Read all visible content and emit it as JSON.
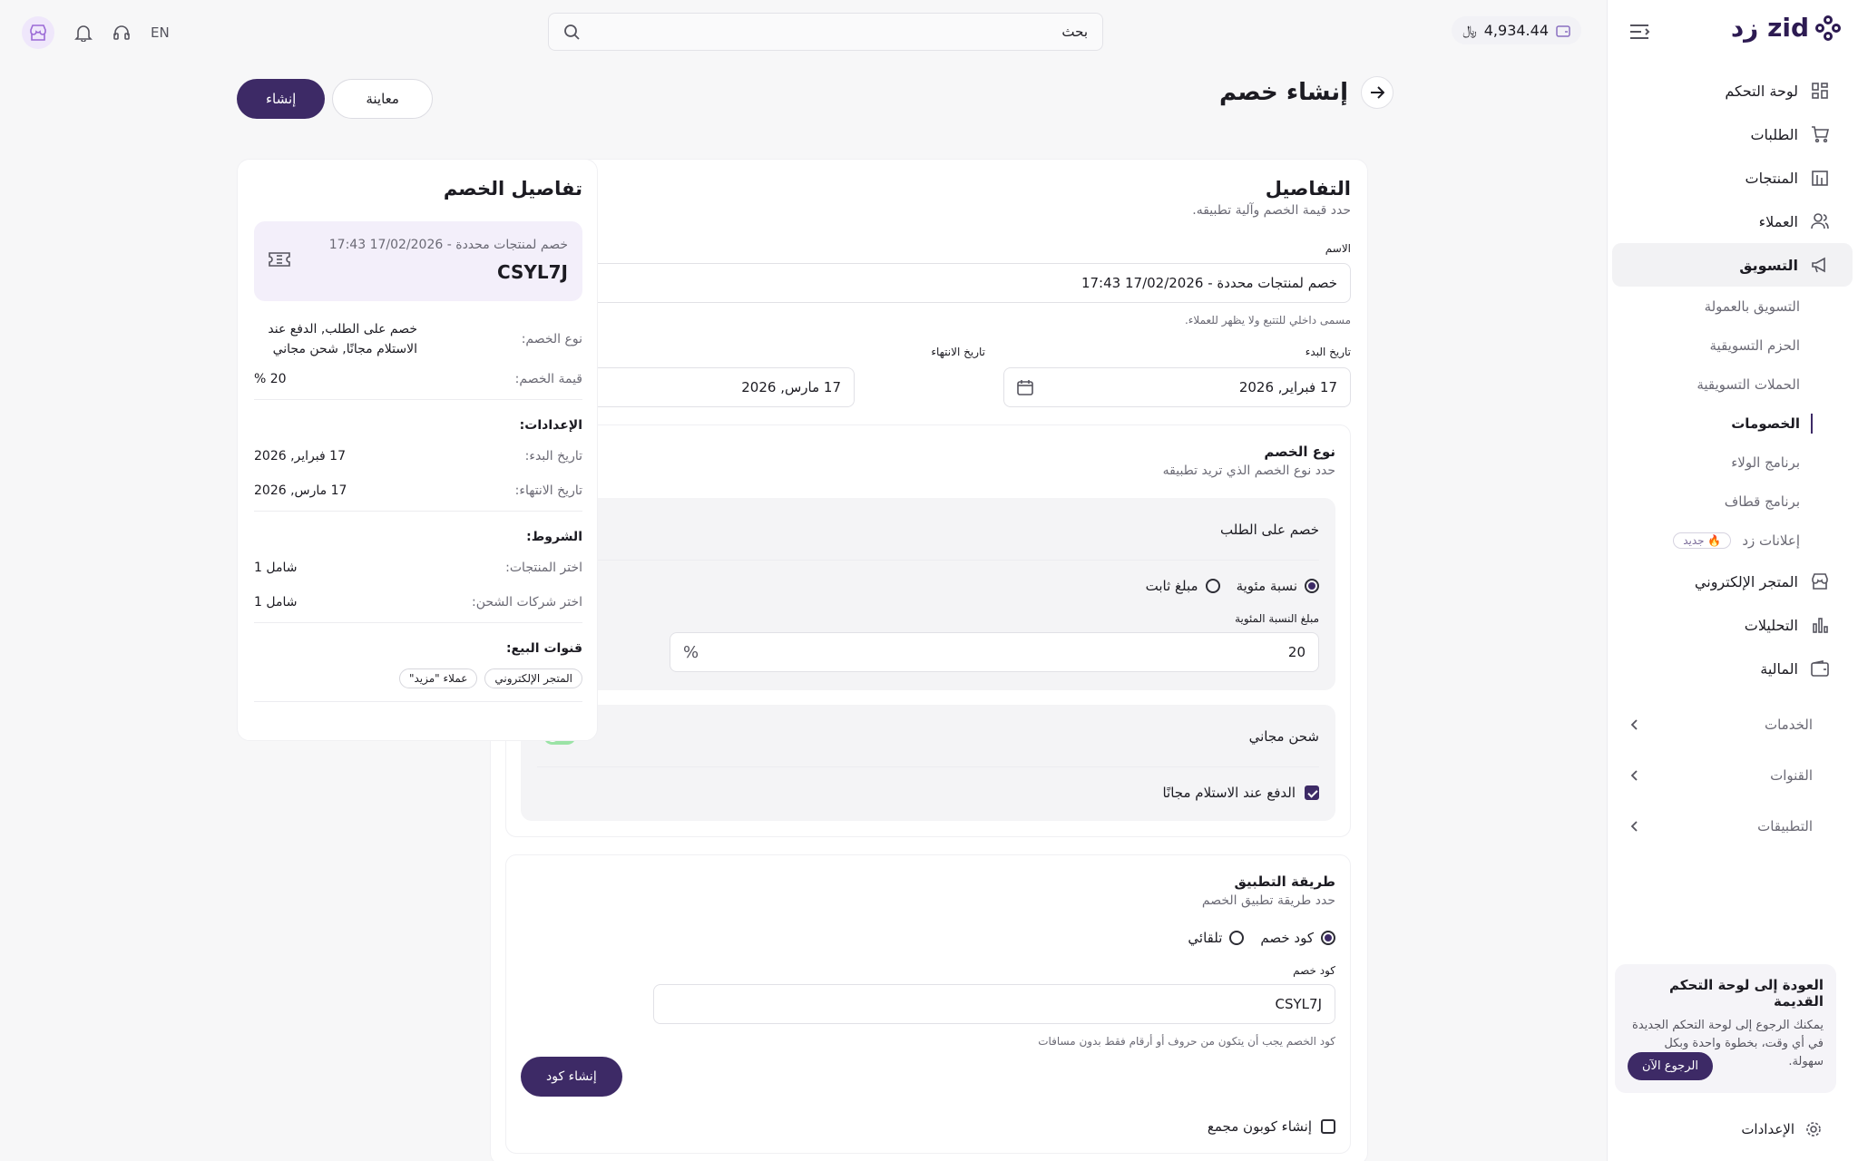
{
  "sidebar": {
    "logo_text": "zid زد",
    "items": [
      {
        "label": "لوحة التحكم",
        "icon": "grid-icon"
      },
      {
        "label": "الطلبات",
        "icon": "cart-icon"
      },
      {
        "label": "المنتجات",
        "icon": "building-icon"
      },
      {
        "label": "العملاء",
        "icon": "users-icon"
      },
      {
        "label": "التسويق",
        "icon": "megaphone-icon"
      }
    ],
    "sub_items": [
      {
        "label": "التسويق بالعمولة"
      },
      {
        "label": "الحزم التسويقية"
      },
      {
        "label": "الحملات التسويقية"
      },
      {
        "label": "الخصومات"
      },
      {
        "label": "برنامج الولاء"
      },
      {
        "label": "برنامج قطاف"
      },
      {
        "label": "إعلانات زد",
        "badge": "🔥 جديد"
      }
    ],
    "items2": [
      {
        "label": "المتجر الإلكتروني",
        "icon": "store-icon"
      },
      {
        "label": "التحليلات",
        "icon": "chart-icon"
      },
      {
        "label": "المالية",
        "icon": "wallet-icon"
      }
    ],
    "groups": [
      {
        "label": "الخدمات"
      },
      {
        "label": "القنوات"
      },
      {
        "label": "التطبيقات"
      }
    ],
    "promo": {
      "title": "العودة إلى لوحة التحكم القديمة",
      "text": "يمكنك الرجوع إلى لوحة التحكم الجديدة في أي وقت، بخطوة واحدة وبكل سهولة.",
      "button": "الرجوع الآن"
    },
    "settings": "الإعدادات"
  },
  "topbar": {
    "balance": "4,934.44",
    "search_placeholder": "بحث",
    "lang": "EN"
  },
  "header": {
    "title": "إنشاء خصم",
    "create_button": "إنشاء",
    "preview_button": "معاينة"
  },
  "details": {
    "title": "التفاصيل",
    "subtitle": "حدد قيمة الخصم وآلية تطبيقه.",
    "name_label": "الاسم",
    "name_value": "خصم لمنتجات محددة - 17/02/2026 17:43",
    "name_hint": "مسمى داخلي للتتبع ولا يظهر للعملاء.",
    "start_label": "تاريخ البدء",
    "start_value": "17 فبراير, 2026",
    "end_label": "تاريخ الانتهاء",
    "end_value": "17 مارس, 2026",
    "type_title": "نوع الخصم",
    "type_subtitle": "حدد نوع الخصم الذي تريد تطبيقه",
    "order_discount_label": "خصم على الطلب",
    "percent_label": "نسبة مئوية",
    "fixed_label": "مبلغ ثابت",
    "percent_amount_label": "مبلغ النسبة المئوية",
    "percent_amount_value": "20",
    "percent_sign": "%",
    "free_shipping_label": "شحن مجاني",
    "cod_free_label": "الدفع عند الاستلام مجانًا",
    "method_title": "طريقة التطبيق",
    "method_subtitle": "حدد طريقة تطبيق الخصم",
    "code_option": "كود خصم",
    "auto_option": "تلقائي",
    "code_label": "كود خصم",
    "code_value": "CSYL7J",
    "code_hint": "كود الخصم يجب أن يتكون من حروف أو أرقام فقط بدون مسافات",
    "generate_button": "إنشاء كود",
    "bulk_label": "إنشاء كوبون مجمع"
  },
  "summary": {
    "title": "تفاصيل الخصم",
    "box_name": "خصم لمنتجات محددة - 17/02/2026 17:43",
    "box_code": "CSYL7J",
    "type_label": "نوع الخصم:",
    "type_value": "خصم على الطلب, الدفع عند الاستلام مجانًا, شحن مجاني",
    "value_label": "قيمة الخصم:",
    "value_value": "20 %",
    "settings_title": "الإعدادات:",
    "start_label": "تاريخ البدء:",
    "start_value": "17 فبراير, 2026",
    "end_label": "تاريخ الانتهاء:",
    "end_value": "17 مارس, 2026",
    "conditions_title": "الشروط:",
    "products_label": "اختر المنتجات:",
    "products_value": "شامل 1",
    "shipping_label": "اختر شركات الشحن:",
    "shipping_value": "شامل 1",
    "channels_title": "قنوات البيع:",
    "channels": [
      "المتجر الإلكتروني",
      "عملاء \"مزيد\""
    ]
  },
  "colors": {
    "primary": "#3d2a66",
    "toggle_on": "#9be3a6",
    "background": "#f7f7f8"
  }
}
